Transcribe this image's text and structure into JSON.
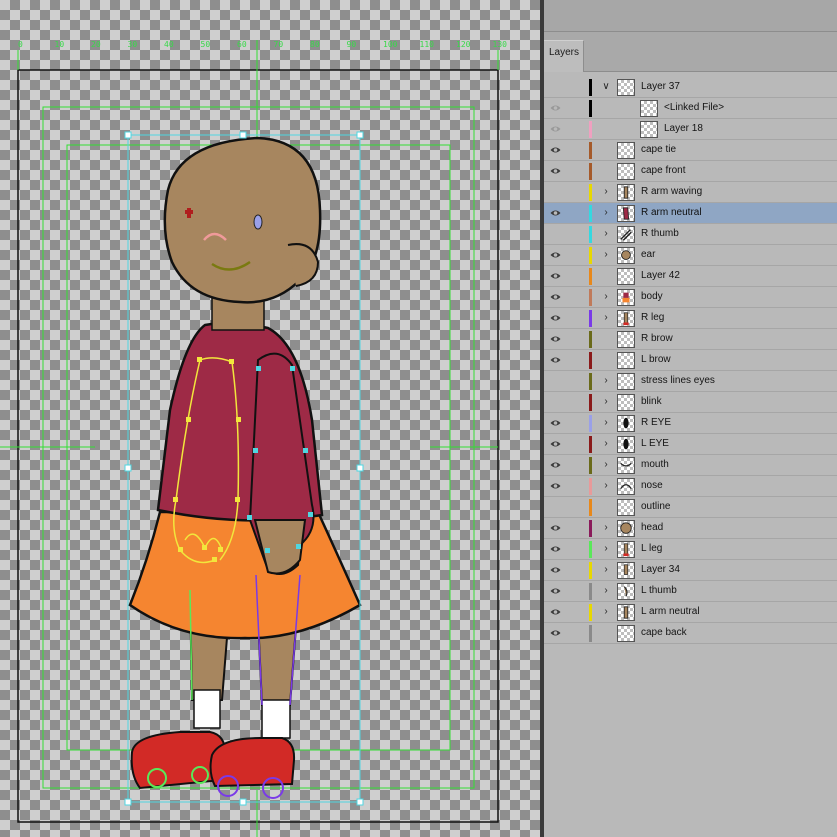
{
  "layers_panel": {
    "tab_label": "Layers",
    "layers": [
      {
        "name": "Layer 37",
        "visible": false,
        "color": "#000000",
        "expander": "open",
        "indent": 0,
        "thumb": "blank"
      },
      {
        "name": "<Linked File>",
        "visible": false,
        "eye_dim": true,
        "color": "#000000",
        "expander": "none",
        "indent": 1,
        "thumb": "blank"
      },
      {
        "name": "Layer 18",
        "visible": false,
        "eye_dim": true,
        "color": "#f0a0c0",
        "expander": "none",
        "indent": 1,
        "thumb": "blank"
      },
      {
        "name": "cape tie",
        "visible": true,
        "color": "#a55a2a",
        "expander": "none",
        "indent": 0,
        "thumb": "blank"
      },
      {
        "name": "cape front",
        "visible": true,
        "color": "#a55a2a",
        "expander": "none",
        "indent": 0,
        "thumb": "blank"
      },
      {
        "name": "R arm waving",
        "visible": false,
        "color": "#e8d800",
        "expander": "closed",
        "indent": 0,
        "thumb": "arm"
      },
      {
        "name": "R arm neutral",
        "visible": true,
        "color": "#35d8e0",
        "expander": "closed",
        "indent": 0,
        "thumb": "arm-red",
        "selected": true
      },
      {
        "name": "R thumb",
        "visible": false,
        "color": "#35d8e0",
        "expander": "closed",
        "indent": 0,
        "thumb": "stroke"
      },
      {
        "name": "ear",
        "visible": true,
        "color": "#e8d800",
        "expander": "closed",
        "indent": 0,
        "thumb": "ear"
      },
      {
        "name": "Layer 42",
        "visible": true,
        "color": "#e8881a",
        "expander": "none",
        "indent": 0,
        "thumb": "blank"
      },
      {
        "name": "body",
        "visible": true,
        "color": "#c07a5a",
        "expander": "closed",
        "indent": 0,
        "thumb": "body"
      },
      {
        "name": "R leg",
        "visible": true,
        "color": "#7a3ae8",
        "expander": "closed",
        "indent": 0,
        "thumb": "leg"
      },
      {
        "name": "R brow",
        "visible": true,
        "color": "#6a6a1a",
        "expander": "none",
        "indent": 0,
        "thumb": "blank"
      },
      {
        "name": "L brow",
        "visible": true,
        "color": "#8a1a1a",
        "expander": "none",
        "indent": 0,
        "thumb": "blank"
      },
      {
        "name": "stress lines eyes",
        "visible": false,
        "color": "#6a6a1a",
        "expander": "closed",
        "indent": 0,
        "thumb": "blank"
      },
      {
        "name": "blink",
        "visible": false,
        "color": "#8a1a1a",
        "expander": "closed",
        "indent": 0,
        "thumb": "blank"
      },
      {
        "name": "R EYE",
        "visible": true,
        "color": "#9aa0e8",
        "expander": "closed",
        "indent": 0,
        "thumb": "eye"
      },
      {
        "name": "L EYE",
        "visible": true,
        "color": "#8a1a1a",
        "expander": "closed",
        "indent": 0,
        "thumb": "eye"
      },
      {
        "name": "mouth",
        "visible": true,
        "color": "#6a6a1a",
        "expander": "closed",
        "indent": 0,
        "thumb": "mouth"
      },
      {
        "name": "nose",
        "visible": true,
        "color": "#e89a9a",
        "expander": "closed",
        "indent": 0,
        "thumb": "nose"
      },
      {
        "name": "outline",
        "visible": false,
        "color": "#e8881a",
        "expander": "none",
        "indent": 0,
        "thumb": "blank"
      },
      {
        "name": "head",
        "visible": true,
        "color": "#8a1a5a",
        "expander": "closed",
        "indent": 0,
        "thumb": "head"
      },
      {
        "name": "L leg",
        "visible": true,
        "color": "#5ae85a",
        "expander": "closed",
        "indent": 0,
        "thumb": "leg"
      },
      {
        "name": "Layer 34",
        "visible": true,
        "color": "#e8d800",
        "expander": "closed",
        "indent": 0,
        "thumb": "leg2"
      },
      {
        "name": "L thumb",
        "visible": true,
        "color": "#8a8a8a",
        "expander": "closed",
        "indent": 0,
        "thumb": "thumb"
      },
      {
        "name": "L arm neutral",
        "visible": true,
        "color": "#e8d800",
        "expander": "closed",
        "indent": 0,
        "thumb": "arm"
      },
      {
        "name": "cape back",
        "visible": true,
        "color": "#8a8a8a",
        "expander": "none",
        "indent": 0,
        "thumb": "blank"
      }
    ]
  },
  "ruler": {
    "top_labels": [
      "0",
      "10",
      "20",
      "30",
      "40",
      "50",
      "60",
      "70",
      "80",
      "90",
      "100",
      "110",
      "120",
      "130"
    ]
  },
  "colors": {
    "selection": "#8fa6c4",
    "guide": "#33dd33",
    "bbox": "#4fd6e0",
    "skin": "#a7865f",
    "sweater": "#9e2a46",
    "skirt": "#f58530",
    "shoe": "#d22a26"
  }
}
